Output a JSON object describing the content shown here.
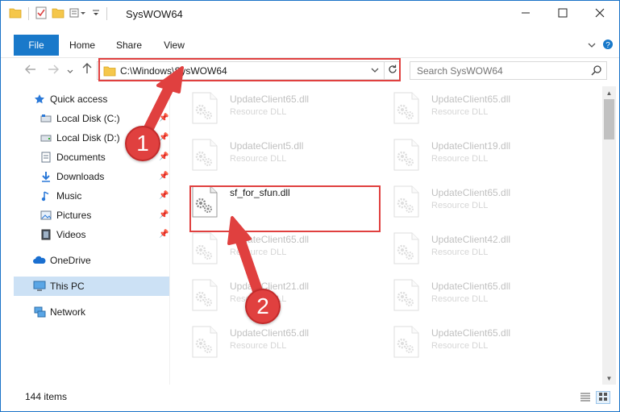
{
  "window": {
    "title": "SysWOW64",
    "controls": {
      "minimize": "minimize-icon",
      "maximize": "maximize-icon",
      "close": "close-icon"
    }
  },
  "ribbon": {
    "tabs": [
      "File",
      "Home",
      "Share",
      "View"
    ]
  },
  "address": {
    "path": "C:\\Windows\\SysWOW64",
    "search_placeholder": "Search SysWOW64"
  },
  "sidebar": {
    "items": [
      {
        "label": "Quick access",
        "icon": "star-icon",
        "pinned": false
      },
      {
        "label": "Local Disk (C:)",
        "icon": "drive-icon",
        "pinned": true
      },
      {
        "label": "Local Disk (D:)",
        "icon": "drive-icon",
        "pinned": true
      },
      {
        "label": "Documents",
        "icon": "documents-icon",
        "pinned": true
      },
      {
        "label": "Downloads",
        "icon": "downloads-icon",
        "pinned": true
      },
      {
        "label": "Music",
        "icon": "music-icon",
        "pinned": true
      },
      {
        "label": "Pictures",
        "icon": "pictures-icon",
        "pinned": true
      },
      {
        "label": "Videos",
        "icon": "videos-icon",
        "pinned": true
      },
      {
        "label": "OneDrive",
        "icon": "onedrive-icon",
        "pinned": false
      },
      {
        "label": "This PC",
        "icon": "this-pc-icon",
        "pinned": false,
        "selected": true
      },
      {
        "label": "Network",
        "icon": "network-icon",
        "pinned": false
      }
    ]
  },
  "files": [
    {
      "name": "UpdateClient65.dll",
      "type": "Resource DLL"
    },
    {
      "name": "UpdateClient65.dll",
      "type": "Resource DLL"
    },
    {
      "name": "UpdateClient5.dll",
      "type": "Resource DLL"
    },
    {
      "name": "UpdateClient19.dll",
      "type": "Resource DLL"
    },
    {
      "name": "sf_for_sfun.dll",
      "type": ""
    },
    {
      "name": "UpdateClient65.dll",
      "type": "Resource DLL"
    },
    {
      "name": "UpdateClient65.dll",
      "type": "Resource DLL"
    },
    {
      "name": "UpdateClient42.dll",
      "type": "Resource DLL"
    },
    {
      "name": "UpdateClient21.dll",
      "type": "Resource DLL"
    },
    {
      "name": "UpdateClient65.dll",
      "type": "Resource DLL"
    },
    {
      "name": "UpdateClient65.dll",
      "type": "Resource DLL"
    },
    {
      "name": "UpdateClient65.dll",
      "type": "Resource DLL"
    }
  ],
  "status": {
    "item_count": "144 items"
  },
  "annotations": {
    "step1": "1",
    "step2": "2",
    "color": "#e0403f"
  },
  "colors": {
    "accent": "#1979ca",
    "selected": "#cce1f5",
    "highlight": "#e0403f"
  }
}
